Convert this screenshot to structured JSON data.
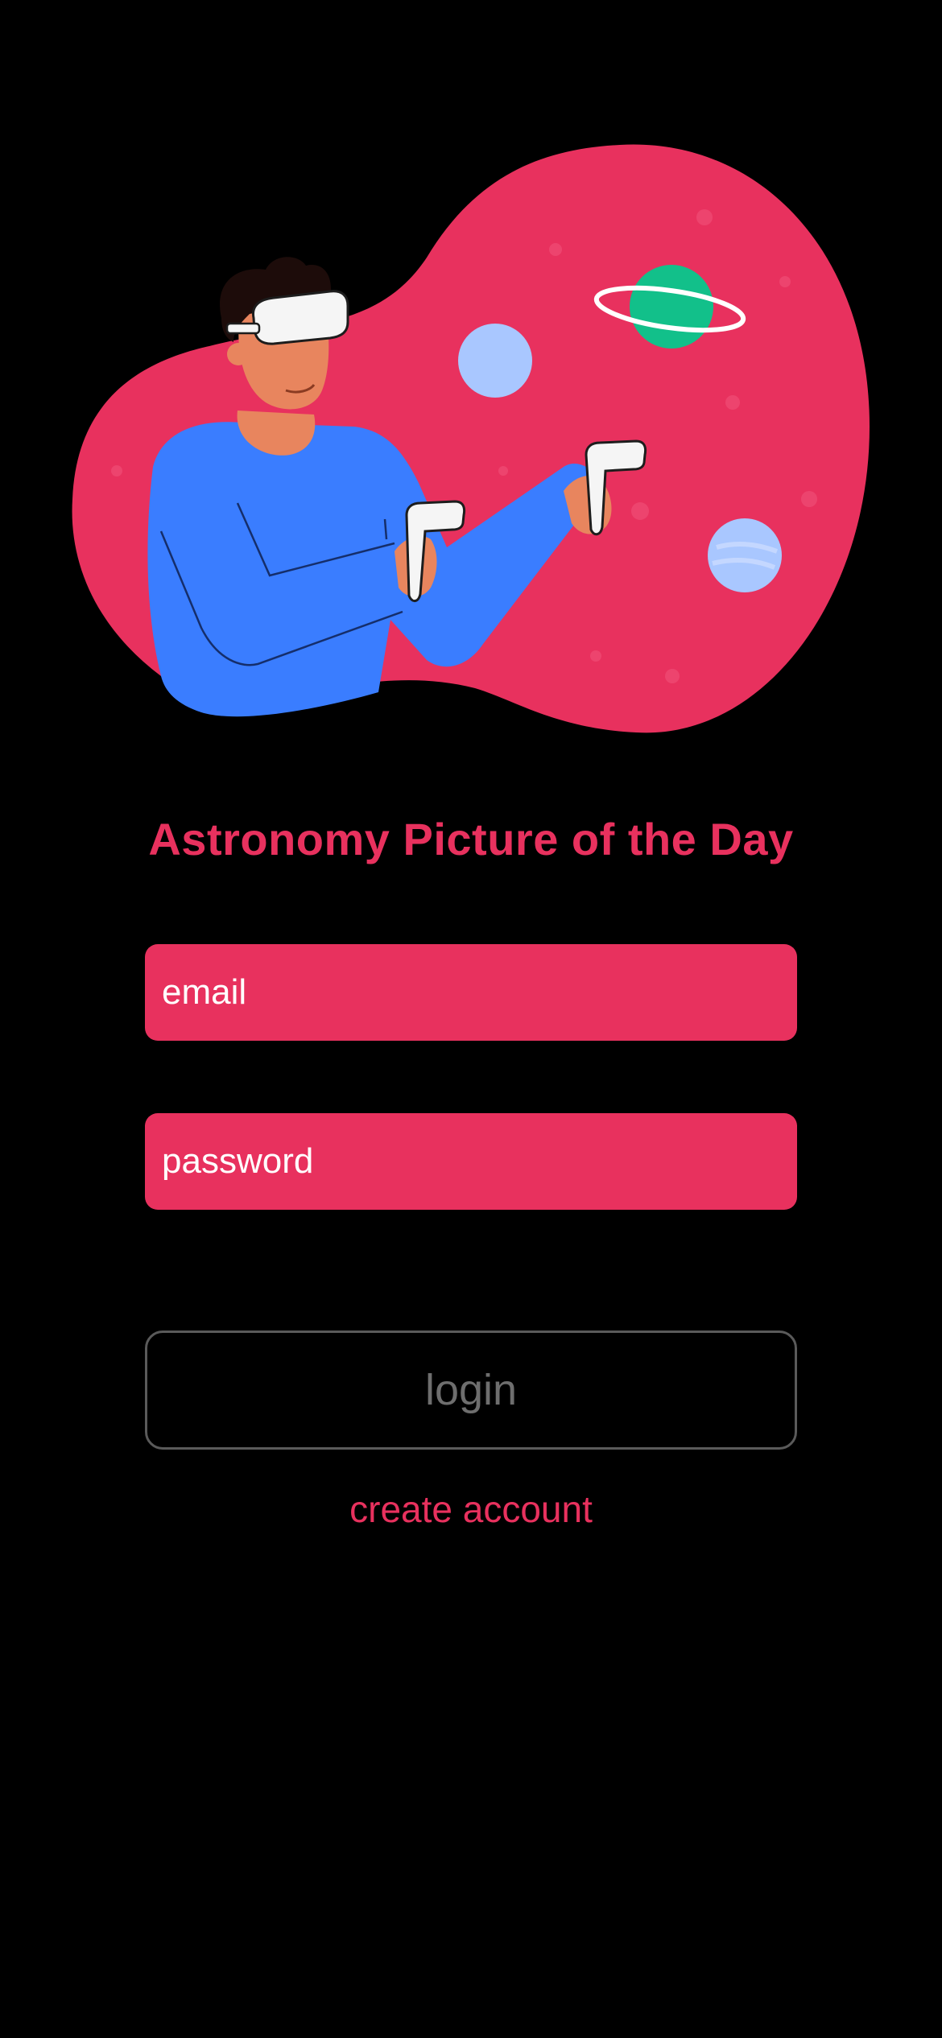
{
  "app": {
    "title": "Astronomy Picture of the Day"
  },
  "illustration": {
    "icon": "person-vr-headset-planets-illustration"
  },
  "form": {
    "email_placeholder": "email",
    "password_placeholder": "password",
    "login_label": "login",
    "create_account_label": "create account"
  },
  "colors": {
    "background": "#000000",
    "accent": "#E8315E",
    "shirt_blue": "#3A7DFF",
    "planet_green": "#12C08A",
    "planet_lightblue": "#A9C7FF",
    "login_border": "#5A5A5A",
    "login_text": "#6E6E6E"
  }
}
